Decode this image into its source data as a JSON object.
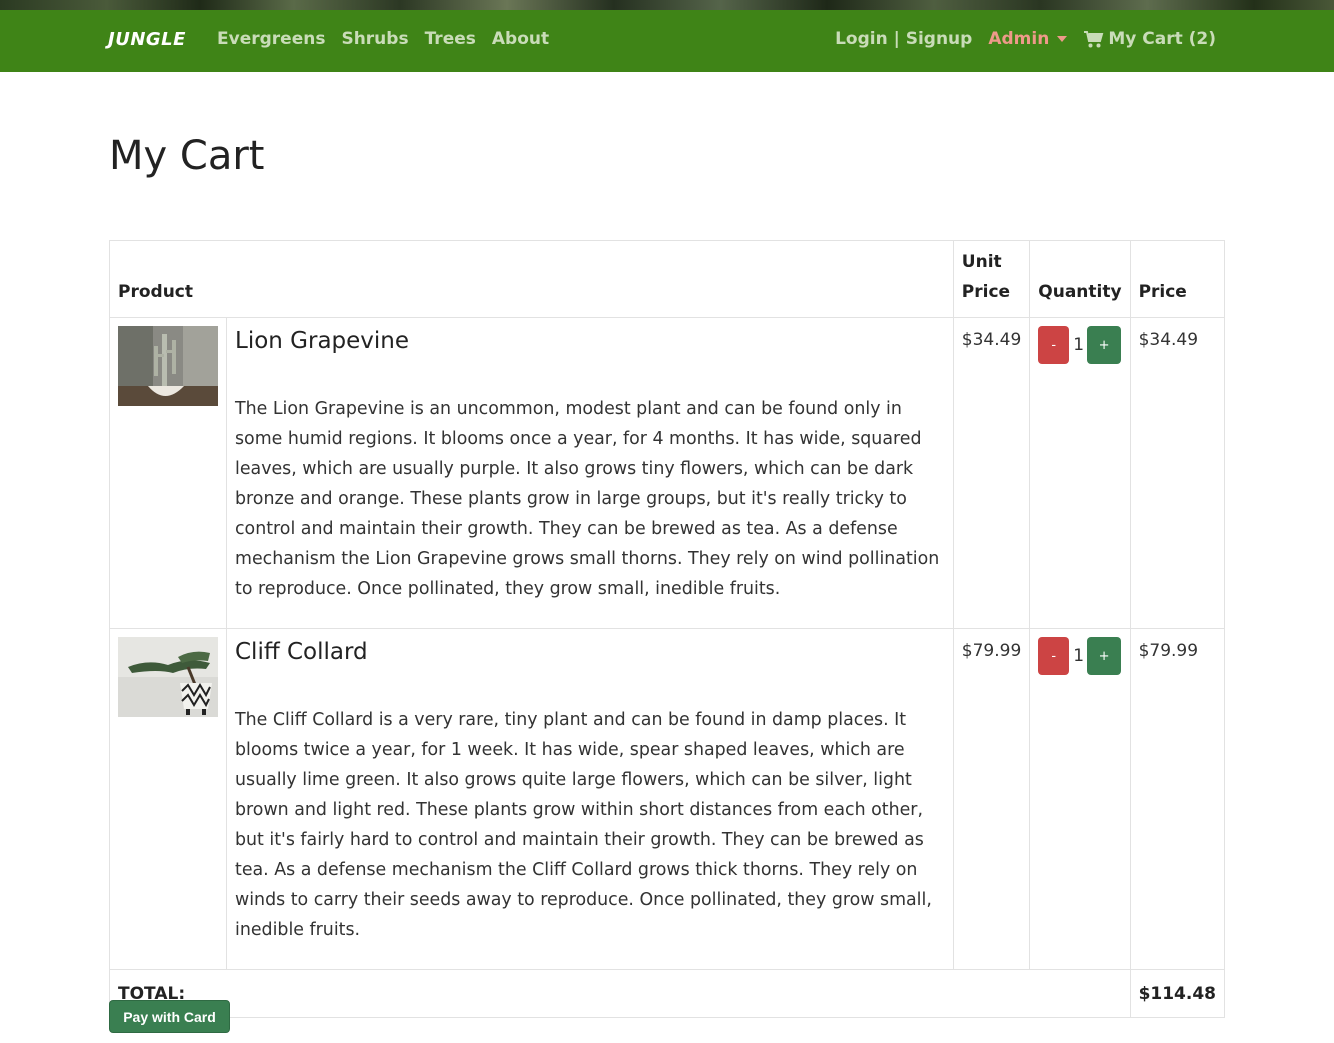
{
  "nav": {
    "brand": "JUNGLE",
    "links": [
      "Evergreens",
      "Shrubs",
      "Trees",
      "About"
    ],
    "login": "Login | Signup",
    "admin": "Admin",
    "cart": "My Cart (2)"
  },
  "page_title": "My Cart",
  "table": {
    "headers": {
      "product": "Product",
      "unit_price_line1": "Unit",
      "unit_price_line2": "Price",
      "quantity": "Quantity",
      "price": "Price"
    },
    "items": [
      {
        "name": "Lion Grapevine",
        "description": "The Lion Grapevine is an uncommon, modest plant and can be found only in some humid regions. It blooms once a year, for 4 months. It has wide, squared leaves, which are usually purple. It also grows tiny flowers, which can be dark bronze and orange. These plants grow in large groups, but it's really tricky to control and maintain their growth. They can be brewed as tea. As a defense mechanism the Lion Grapevine grows small thorns. They rely on wind pollination to reproduce. Once pollinated, they grow small, inedible fruits.",
        "unit_price": "$34.49",
        "quantity": "1",
        "price": "$34.49",
        "minus": "-",
        "plus": "+"
      },
      {
        "name": "Cliff Collard",
        "description": "The Cliff Collard is a very rare, tiny plant and can be found in damp places. It blooms twice a year, for 1 week. It has wide, spear shaped leaves, which are usually lime green. It also grows quite large flowers, which can be silver, light brown and light red. These plants grow within short distances from each other, but it's fairly hard to control and maintain their growth. They can be brewed as tea. As a defense mechanism the Cliff Collard grows thick thorns. They rely on winds to carry their seeds away to reproduce. Once pollinated, they grow small, inedible fruits.",
        "unit_price": "$79.99",
        "quantity": "1",
        "price": "$79.99",
        "minus": "-",
        "plus": "+"
      }
    ],
    "total_label": "TOTAL:",
    "total_value": "$114.48"
  },
  "pay_button": "Pay with Card",
  "colors": {
    "navbar": "#3f8417",
    "nav_link": "#c9dcb8",
    "admin": "#ee9a8a",
    "minus_button": "#cc4444",
    "plus_button": "#3a7f51"
  }
}
